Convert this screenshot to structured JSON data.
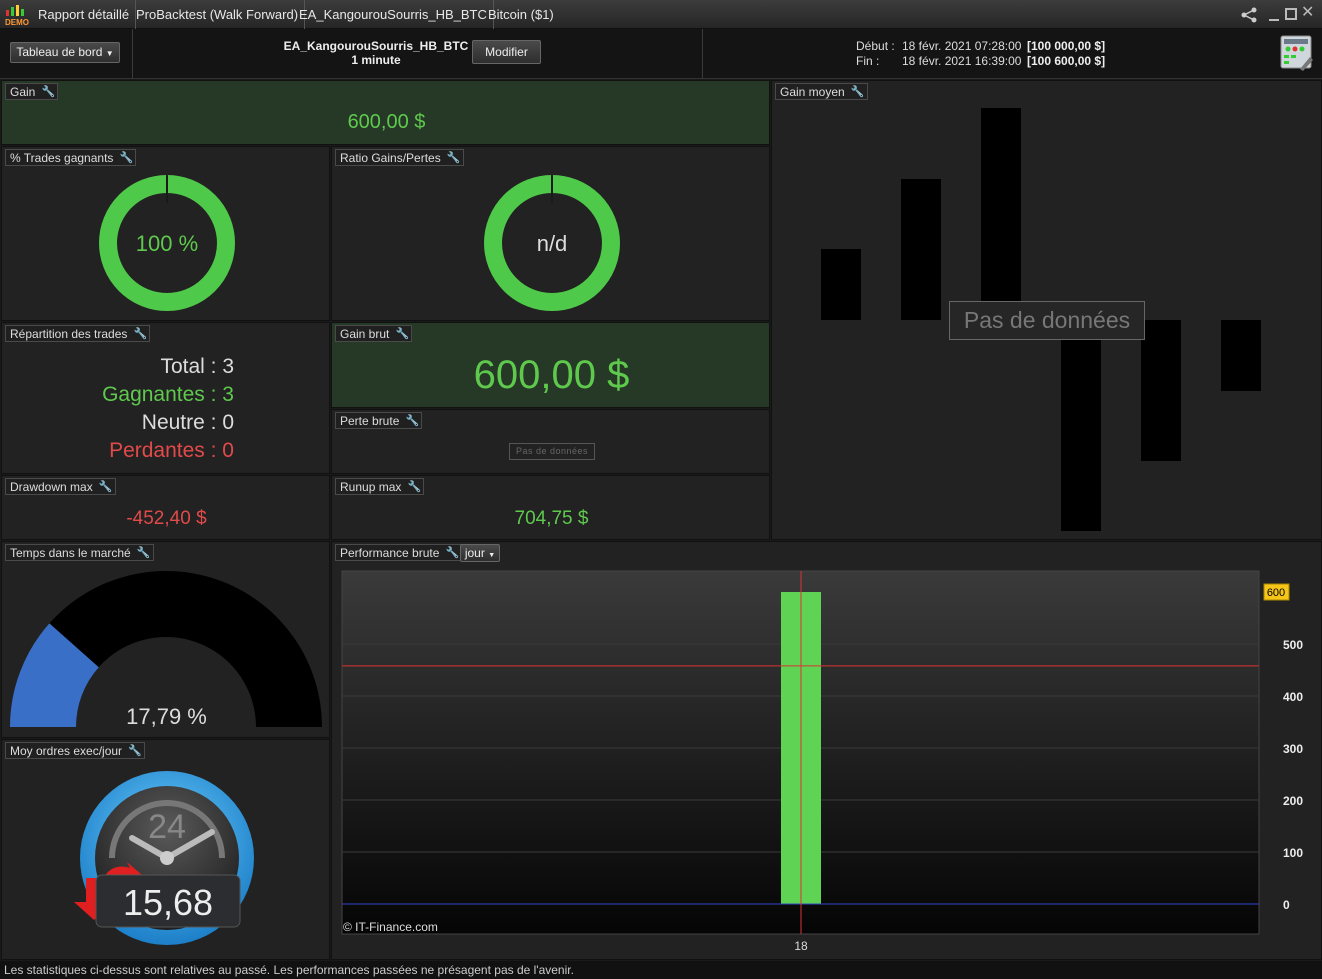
{
  "titlebar": {
    "logo_text": "DEMO",
    "tabs": [
      "Rapport détaillé",
      "ProBacktest (Walk Forward)",
      "EA_KangourouSourris_HB_BTC",
      "Bitcoin ($1)"
    ]
  },
  "header": {
    "dashboard_select": "Tableau de bord",
    "system_name": "EA_KangourouSourris_HB_BTC",
    "timeframe": "1 minute",
    "modify_label": "Modifier",
    "start_label": "Début :",
    "start_date": "18 févr. 2021 07:28:00",
    "start_capital": "[100 000,00 $]",
    "end_label": "Fin :",
    "end_date": "18 févr. 2021 16:39:00",
    "end_capital": "[100 600,00 $]"
  },
  "gain": {
    "title": "Gain",
    "value": "600,00 $"
  },
  "win_trades": {
    "title": "% Trades gagnants",
    "value": "100 %",
    "percent": 100
  },
  "ratio": {
    "title": "Ratio Gains/Pertes",
    "value": "n/d"
  },
  "gain_moyen": {
    "title": "Gain moyen",
    "no_data": "Pas de données"
  },
  "repartition": {
    "title": "Répartition des trades",
    "total": "Total : 3",
    "winners": "Gagnantes : 3",
    "neutral": "Neutre : 0",
    "losers": "Perdantes : 0"
  },
  "gain_brut": {
    "title": "Gain brut",
    "value": "600,00 $"
  },
  "perte_brute": {
    "title": "Perte brute",
    "no_data": "Pas de données"
  },
  "drawdown": {
    "title": "Drawdown max",
    "value": "-452,40 $"
  },
  "runup": {
    "title": "Runup max",
    "value": "704,75 $"
  },
  "temps_marche": {
    "title": "Temps dans le marché",
    "value": "17,79 %",
    "percent": 17.79
  },
  "moy_ordres": {
    "title": "Moy ordres exec/jour",
    "clock_label": "24",
    "value": "15,68"
  },
  "performance": {
    "title": "Performance brute",
    "period": "jour",
    "copyright": "© IT-Finance.com"
  },
  "chart_data": {
    "type": "bar",
    "categories": [
      "18"
    ],
    "values": [
      600
    ],
    "ylim": [
      0,
      650
    ],
    "yticks": [
      "0",
      "100",
      "200",
      "300",
      "400",
      "500"
    ],
    "highlight_label": "600",
    "crosshair_y": 458,
    "colors": {
      "bar": "#5ed354",
      "zero_line": "#3344cc",
      "crosshair": "#d33"
    }
  },
  "footer": "Les statistiques ci-dessus sont relatives au passé. Les performances passées ne présagent pas de l'avenir.",
  "colors": {
    "green": "#5fc94e",
    "red": "#e24a4a",
    "accent_blue": "#3a6fc8"
  }
}
